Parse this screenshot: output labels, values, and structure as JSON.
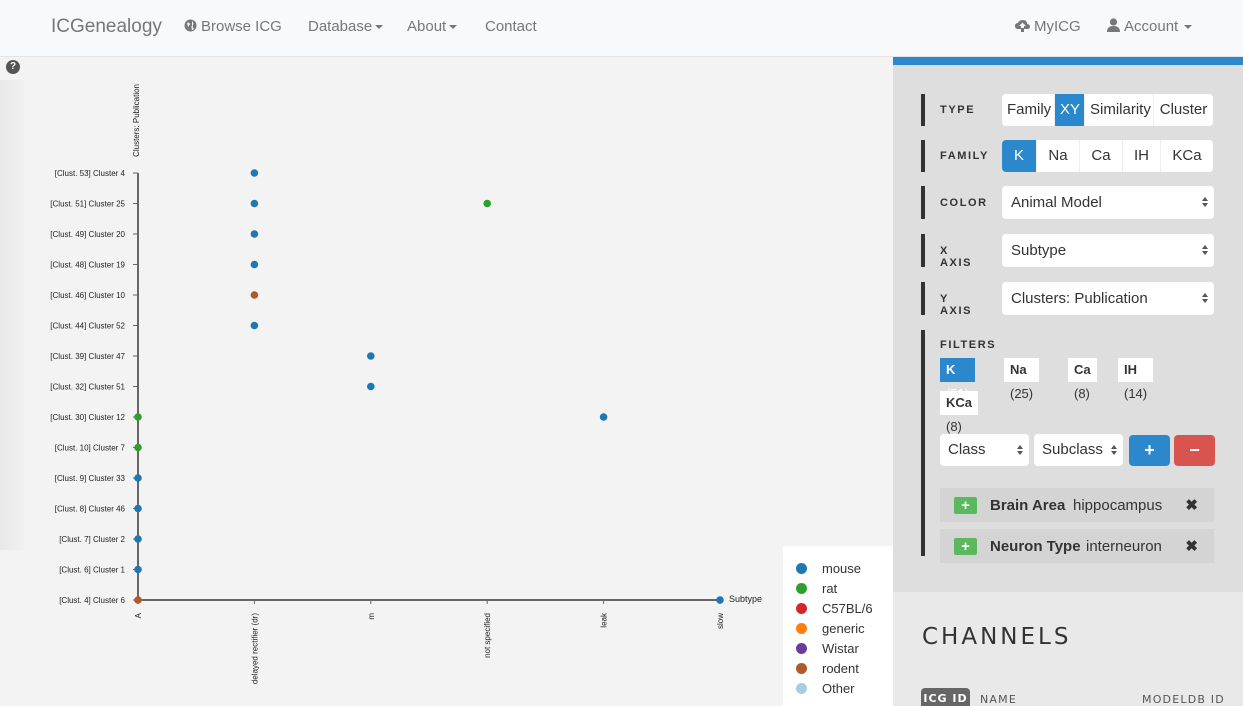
{
  "nav": {
    "brand": "ICGenealogy",
    "browse": "Browse ICG",
    "database": "Database",
    "about": "About",
    "contact": "Contact",
    "myicg": "MyICG",
    "account": "Account"
  },
  "help": "?",
  "panel": {
    "type_label": "TYPE",
    "type_options": [
      "Family",
      "XY",
      "Similarity",
      "Cluster"
    ],
    "type_active": "XY",
    "family_label": "FAMILY",
    "family_options": [
      "K",
      "Na",
      "Ca",
      "IH",
      "KCa"
    ],
    "family_active": "K",
    "color_label": "COLOR",
    "color_value": "Animal Model",
    "xaxis_label": "X AXIS",
    "xaxis_value": "Subtype",
    "yaxis_label": "Y AXIS",
    "yaxis_value": "Clusters: Publication",
    "filters_label": "FILTERS",
    "filter_chips": [
      {
        "name": "K",
        "count": "(51)",
        "active": true
      },
      {
        "name": "Na",
        "count": "(25)",
        "active": false
      },
      {
        "name": "Ca",
        "count": "(8)",
        "active": false
      },
      {
        "name": "IH",
        "count": "(14)",
        "active": false
      },
      {
        "name": "KCa",
        "count": "(8)",
        "active": false
      }
    ],
    "class_select": "Class",
    "subclass_select": "Subclass",
    "add_label": "+",
    "remove_label": "−",
    "criteria": [
      {
        "key": "Brain Area",
        "value": "hippocampus"
      },
      {
        "key": "Neuron Type",
        "value": "interneuron"
      }
    ],
    "criteria_plus": "+",
    "criteria_remove": "✖"
  },
  "channels": {
    "title": "CHANNELS",
    "columns": [
      "ICG ID",
      "NAME",
      "MODELDB ID"
    ]
  },
  "chart_data": {
    "type": "scatter",
    "xlabel": "Subtype",
    "ylabel": "Clusters: Publication",
    "x_categories": [
      "A",
      "delayed rectifier (dr)",
      "m",
      "not specified",
      "leak",
      "slow"
    ],
    "y_categories": [
      "[Clust. 4] Cluster 6",
      "[Clust. 6] Cluster 1",
      "[Clust. 7] Cluster 2",
      "[Clust. 8] Cluster 46",
      "[Clust. 9] Cluster 33",
      "[Clust. 10] Cluster 7",
      "[Clust. 30] Cluster 12",
      "[Clust. 32] Cluster 51",
      "[Clust. 39] Cluster 47",
      "[Clust. 44] Cluster 52",
      "[Clust. 46] Cluster 10",
      "[Clust. 48] Cluster 19",
      "[Clust. 49] Cluster 20",
      "[Clust. 51] Cluster 25",
      "[Clust. 53] Cluster 4"
    ],
    "legend": [
      {
        "name": "mouse",
        "color": "#1f77b4"
      },
      {
        "name": "rat",
        "color": "#2ca02c"
      },
      {
        "name": "C57BL/6",
        "color": "#d62728"
      },
      {
        "name": "generic",
        "color": "#ff7f0e"
      },
      {
        "name": "Wistar",
        "color": "#6a3d9a"
      },
      {
        "name": "rodent",
        "color": "#b15928"
      },
      {
        "name": "Other",
        "color": "#a6cee3"
      }
    ],
    "legend_position": "bottom-right",
    "points": [
      {
        "x": "A",
        "y": "[Clust. 4] Cluster 6",
        "group": "rodent"
      },
      {
        "x": "A",
        "y": "[Clust. 6] Cluster 1",
        "group": "mouse"
      },
      {
        "x": "A",
        "y": "[Clust. 7] Cluster 2",
        "group": "mouse"
      },
      {
        "x": "A",
        "y": "[Clust. 8] Cluster 46",
        "group": "mouse"
      },
      {
        "x": "A",
        "y": "[Clust. 9] Cluster 33",
        "group": "mouse"
      },
      {
        "x": "A",
        "y": "[Clust. 10] Cluster 7",
        "group": "rat"
      },
      {
        "x": "A",
        "y": "[Clust. 30] Cluster 12",
        "group": "rat"
      },
      {
        "x": "delayed rectifier (dr)",
        "y": "[Clust. 44] Cluster 52",
        "group": "mouse"
      },
      {
        "x": "delayed rectifier (dr)",
        "y": "[Clust. 46] Cluster 10",
        "group": "rodent"
      },
      {
        "x": "delayed rectifier (dr)",
        "y": "[Clust. 48] Cluster 19",
        "group": "mouse"
      },
      {
        "x": "delayed rectifier (dr)",
        "y": "[Clust. 49] Cluster 20",
        "group": "mouse"
      },
      {
        "x": "delayed rectifier (dr)",
        "y": "[Clust. 51] Cluster 25",
        "group": "mouse"
      },
      {
        "x": "delayed rectifier (dr)",
        "y": "[Clust. 53] Cluster 4",
        "group": "mouse"
      },
      {
        "x": "m",
        "y": "[Clust. 32] Cluster 51",
        "group": "mouse"
      },
      {
        "x": "m",
        "y": "[Clust. 39] Cluster 47",
        "group": "mouse"
      },
      {
        "x": "not specified",
        "y": "[Clust. 51] Cluster 25",
        "group": "rat"
      },
      {
        "x": "leak",
        "y": "[Clust. 30] Cluster 12",
        "group": "mouse"
      },
      {
        "x": "slow",
        "y": "[Clust. 4] Cluster 6",
        "group": "mouse"
      }
    ]
  }
}
